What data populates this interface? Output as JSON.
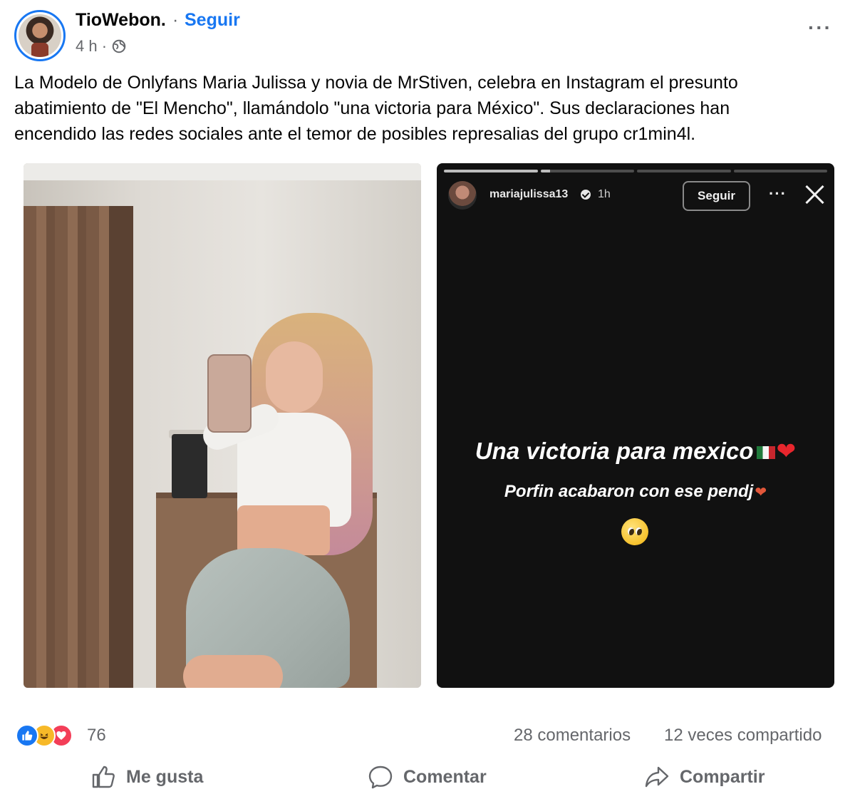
{
  "post": {
    "author": "TioWebon.",
    "separator": "·",
    "follow_label": "Seguir",
    "time": "4 h ·",
    "audience_icon": "globe-icon",
    "more_icon": "more-horizontal-icon",
    "caption": "La Modelo de Onlyfans Maria Julissa y novia de MrStiven, celebra en Instagram el presunto abatimiento de \"El Mencho\", llamándolo \"una victoria para México\". Sus declaraciones han encendido las redes sociales ante el temor de posibles represalias del grupo cr1min4l."
  },
  "story": {
    "username": "mariajulissa13",
    "time": "1h",
    "follow_label": "Seguir",
    "more_label": "···",
    "line1": "Una victoria para mexico",
    "line2": "Porfin acabaron con ese pendj",
    "progress_segments": 4,
    "active_segment": 1
  },
  "engagement": {
    "reaction_icons": [
      "like-reaction-icon",
      "haha-reaction-icon",
      "love-reaction-icon"
    ],
    "reaction_count": "76",
    "comments": "28 comentarios",
    "shares": "12 veces compartido"
  },
  "actions": {
    "like": "Me gusta",
    "comment": "Comentar",
    "share": "Compartir"
  },
  "colors": {
    "accent": "#1877f2",
    "muted_text": "#65676b",
    "story_bg": "#111111"
  }
}
